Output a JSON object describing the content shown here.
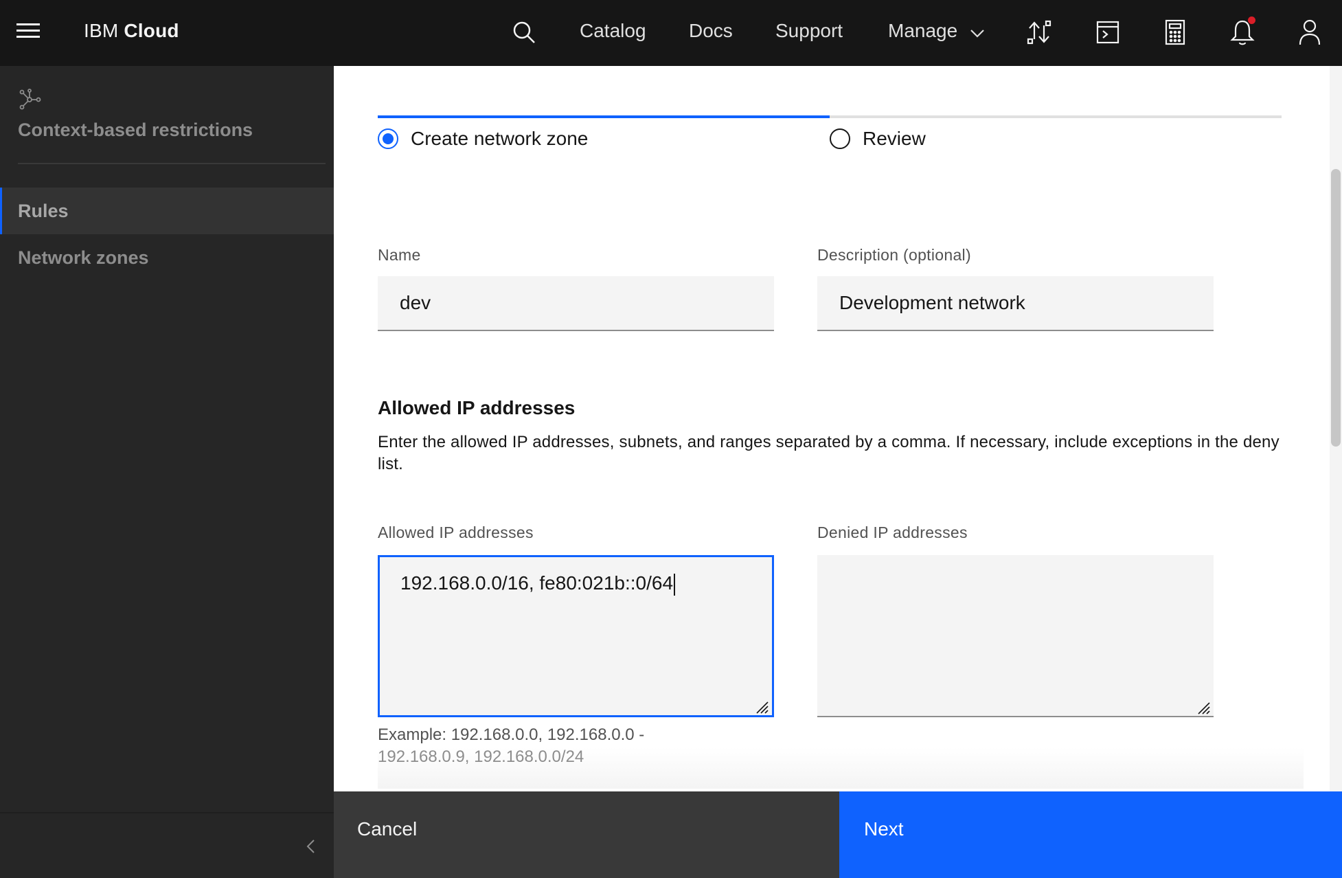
{
  "header": {
    "brand_light": "IBM ",
    "brand_bold": "Cloud",
    "nav": {
      "catalog": "Catalog",
      "docs": "Docs",
      "support": "Support",
      "manage": "Manage"
    },
    "icons": [
      "menu-icon",
      "search-icon",
      "chevron-down-icon",
      "switch-account-icon",
      "cloud-shell-icon",
      "cost-estimator-icon",
      "notification-icon",
      "user-avatar-icon"
    ],
    "notification_color": "#da1e28"
  },
  "sidenav": {
    "product_icon": "network-icon",
    "title": "Context-based restrictions",
    "items": [
      {
        "label": "Rules",
        "active": true
      },
      {
        "label": "Network zones",
        "active": false
      }
    ],
    "collapse_icon": "chevron-left-icon"
  },
  "wizard": {
    "progress_fraction": 0.5,
    "steps": [
      {
        "label": "Create network zone",
        "state": "current"
      },
      {
        "label": "Review",
        "state": "incomplete"
      }
    ]
  },
  "form": {
    "name": {
      "label": "Name",
      "value": "dev"
    },
    "description": {
      "label": "Description (optional)",
      "value": "Development network"
    },
    "allowed_section": {
      "title": "Allowed IP addresses",
      "description": "Enter the allowed IP addresses, subnets, and ranges separated by a comma. If necessary, include exceptions in the deny list."
    },
    "allowed_ips": {
      "label": "Allowed IP addresses",
      "value": "192.168.0.0/16, fe80:021b::0/64"
    },
    "denied_ips": {
      "label": "Denied IP addresses",
      "value": ""
    },
    "helper_line1": "Example: 192.168.0.0, 192.168.0.0 -",
    "helper_line2": "192.168.0.9, 192.168.0.0/24"
  },
  "footer": {
    "cancel": "Cancel",
    "next": "Next"
  },
  "colors": {
    "primary": "#0f62fe",
    "header_bg": "#161616",
    "sidenav_bg": "#262626",
    "field_bg": "#f4f4f4"
  }
}
